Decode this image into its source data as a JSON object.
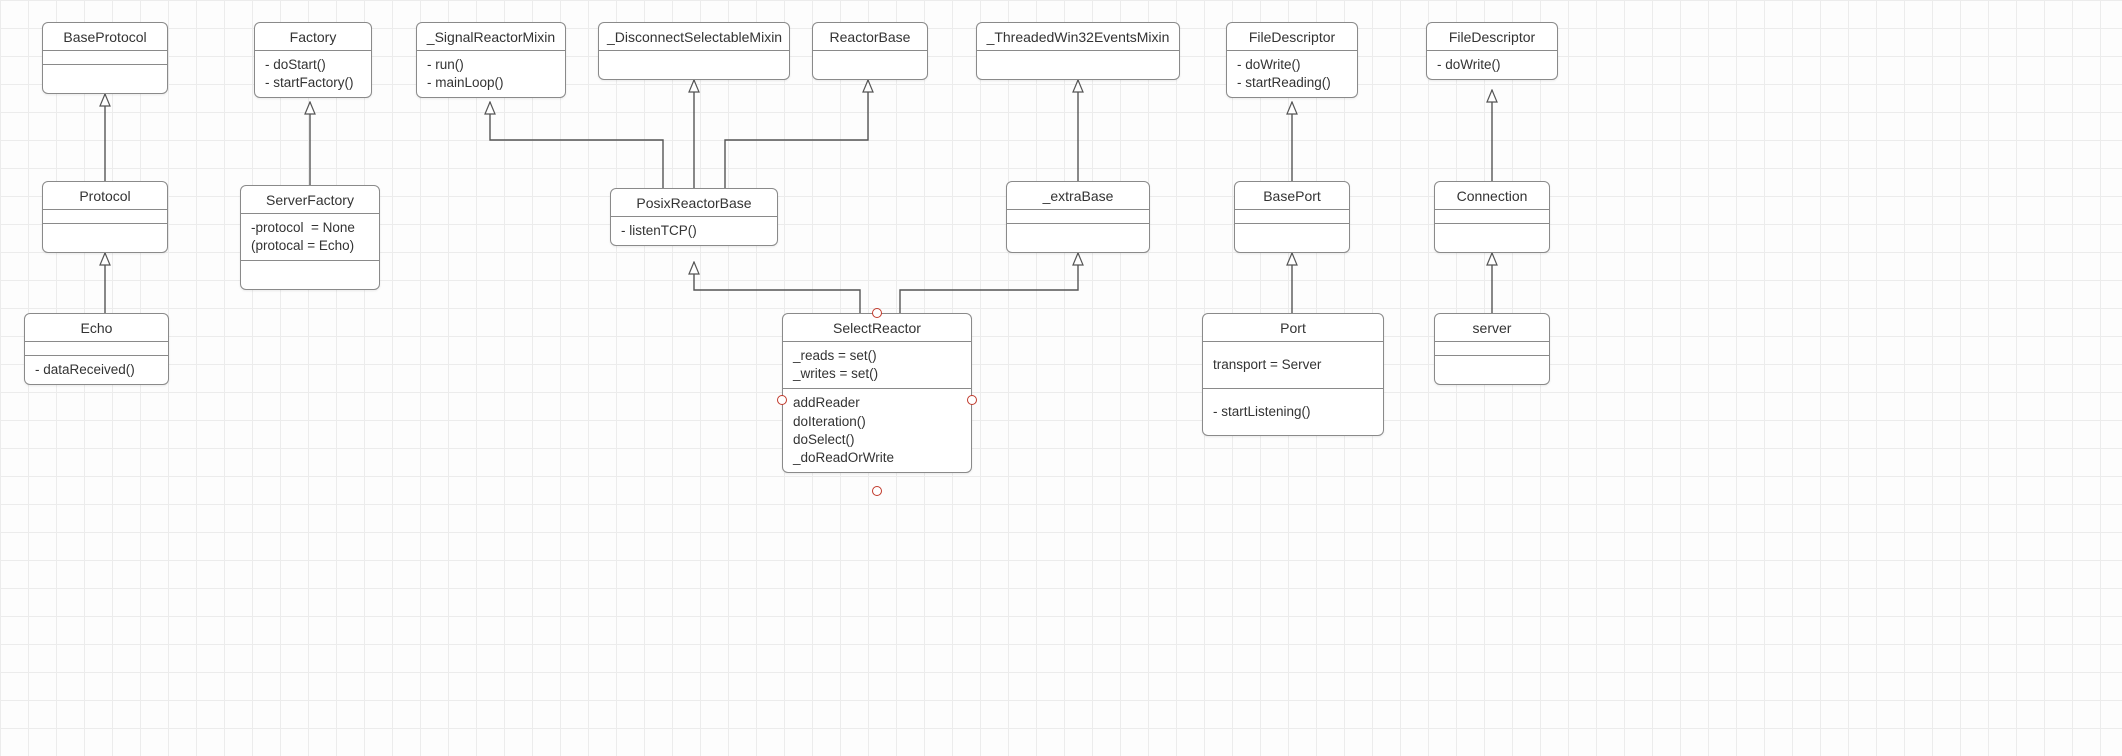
{
  "classes": {
    "baseProtocol": {
      "name": "BaseProtocol"
    },
    "protocol": {
      "name": "Protocol"
    },
    "echo": {
      "name": "Echo",
      "ops": [
        "- dataReceived()"
      ]
    },
    "factory": {
      "name": "Factory",
      "ops": [
        "- doStart()",
        "- startFactory()"
      ]
    },
    "serverFactory": {
      "name": "ServerFactory",
      "attrs": [
        "-protocol  = None",
        "(protocal = Echo)"
      ]
    },
    "signalReactorMixin": {
      "name": "_SignalReactorMixin",
      "ops": [
        "- run()",
        "- mainLoop()"
      ]
    },
    "disconnectSelectableMixin": {
      "name": "_DisconnectSelectableMixin"
    },
    "reactorBase": {
      "name": "ReactorBase"
    },
    "threadedWin32EventsMixin": {
      "name": "_ThreadedWin32EventsMixin"
    },
    "posixReactorBase": {
      "name": "PosixReactorBase",
      "ops": [
        "- listenTCP()"
      ]
    },
    "extraBase": {
      "name": "_extraBase"
    },
    "selectReactor": {
      "name": "SelectReactor",
      "attrs": [
        "_reads = set()",
        "_writes = set()"
      ],
      "ops": [
        "addReader",
        "doIteration()",
        "doSelect()",
        "_doReadOrWrite"
      ]
    },
    "fileDescriptor1": {
      "name": "FileDescriptor",
      "ops": [
        "- doWrite()",
        "- startReading()"
      ]
    },
    "basePort": {
      "name": "BasePort"
    },
    "port": {
      "name": "Port",
      "attrs": [
        "transport = Server"
      ],
      "ops": [
        "- startListening()"
      ]
    },
    "fileDescriptor2": {
      "name": "FileDescriptor",
      "ops": [
        "- doWrite()"
      ]
    },
    "connection": {
      "name": "Connection"
    },
    "server": {
      "name": "server"
    }
  },
  "edges": [
    {
      "from": "echo",
      "to": "protocol",
      "type": "generalization"
    },
    {
      "from": "protocol",
      "to": "baseProtocol",
      "type": "generalization"
    },
    {
      "from": "serverFactory",
      "to": "factory",
      "type": "generalization"
    },
    {
      "from": "posixReactorBase",
      "to": "signalReactorMixin",
      "type": "generalization"
    },
    {
      "from": "posixReactorBase",
      "to": "disconnectSelectableMixin",
      "type": "generalization"
    },
    {
      "from": "posixReactorBase",
      "to": "reactorBase",
      "type": "generalization"
    },
    {
      "from": "extraBase",
      "to": "threadedWin32EventsMixin",
      "type": "generalization"
    },
    {
      "from": "selectReactor",
      "to": "posixReactorBase",
      "type": "generalization"
    },
    {
      "from": "selectReactor",
      "to": "extraBase",
      "type": "generalization"
    },
    {
      "from": "basePort",
      "to": "fileDescriptor1",
      "type": "generalization"
    },
    {
      "from": "port",
      "to": "basePort",
      "type": "generalization"
    },
    {
      "from": "connection",
      "to": "fileDescriptor2",
      "type": "generalization"
    },
    {
      "from": "server",
      "to": "connection",
      "type": "generalization"
    }
  ]
}
